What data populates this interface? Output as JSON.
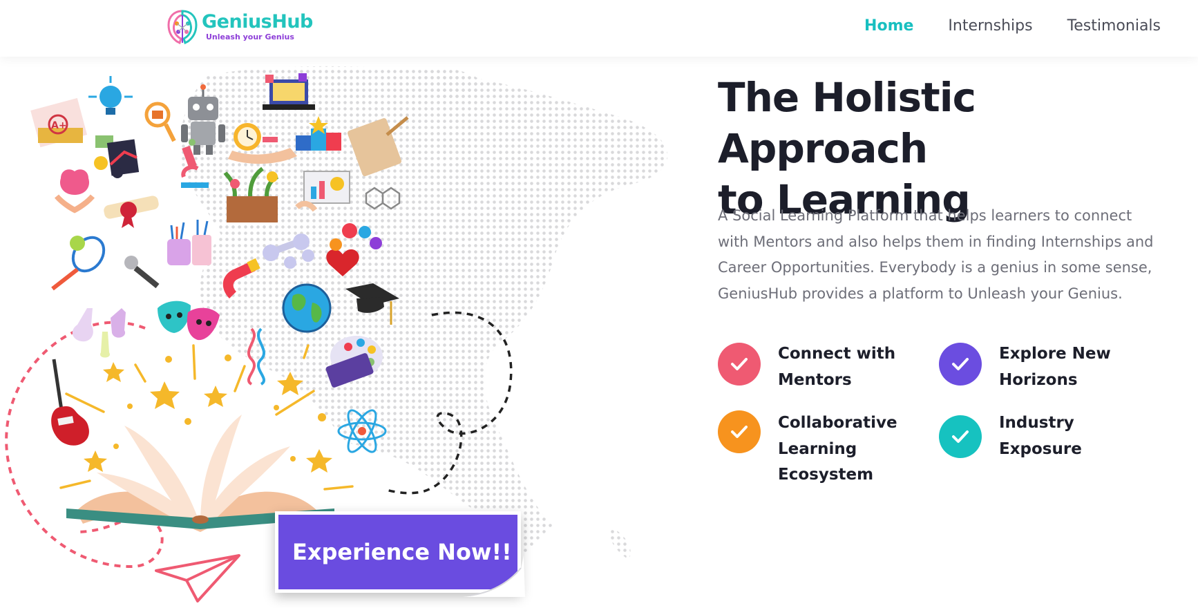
{
  "header": {
    "brand": "GeniusHub",
    "tagline": "Unleash your Genius",
    "nav": [
      {
        "label": "Home",
        "active": true
      },
      {
        "label": "Internships",
        "active": false
      },
      {
        "label": "Testimonials",
        "active": false
      }
    ]
  },
  "hero": {
    "title_line1": "The Holistic Approach",
    "title_line2": "to Learning",
    "description": "A Social Learning Platform that helps learners to connect with Mentors and also helps them in finding Internships and Career Opportunities. Everybody is a genius in some sense, GeniusHub provides a platform to Unleash your Genius."
  },
  "features": [
    {
      "line1": "Connect with",
      "line2": "Mentors",
      "line3": "",
      "color": "#ef5a72"
    },
    {
      "line1": "Explore New",
      "line2": "Horizons",
      "line3": "",
      "color": "#6b4de0"
    },
    {
      "line1": "Collaborative",
      "line2": "Learning",
      "line3": "Ecosystem",
      "color": "#f7931e"
    },
    {
      "line1": "Industry",
      "line2": "Exposure",
      "line3": "",
      "color": "#16c2c0"
    }
  ],
  "cta": {
    "label": "Experience Now!!"
  },
  "colors": {
    "accent": "#18bfc0",
    "primary": "#6a4ce0",
    "text": "#1c1e2a",
    "muted": "#6d6e78"
  },
  "illustration_icons": [
    "grade-a-plus-icon",
    "lightbulb-icon",
    "magnifier-icon",
    "robot-icon",
    "laptop-icon",
    "trophy-podium-icon",
    "alarm-clock-icon",
    "notebook-icon",
    "money-growth-icon",
    "brain-icon",
    "microscope-icon",
    "plants-icon",
    "charts-icon",
    "molecule-icon",
    "certificate-icon",
    "tennis-icon",
    "microphone-icon",
    "art-supplies-icon",
    "dumbbell-icon",
    "health-heart-icon",
    "magnet-icon",
    "globe-icon",
    "graduation-cap-icon",
    "flask-icon",
    "theater-masks-icon",
    "dna-icon",
    "paint-palette-icon",
    "guitar-icon",
    "atom-icon",
    "open-book-icon",
    "paper-plane-icon"
  ]
}
